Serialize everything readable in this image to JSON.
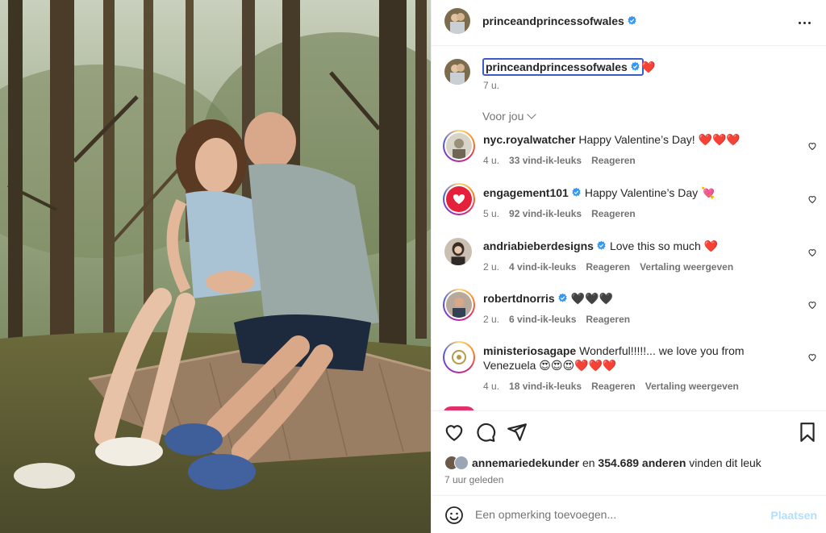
{
  "post": {
    "username": "princeandprincessofwales",
    "caption_emoji": "❤️",
    "caption_time": "7 u.",
    "sort_label": "Voor jou"
  },
  "comments": [
    {
      "username": "nyc.royalwatcher",
      "verified": false,
      "text": "Happy Valentine’s Day! ❤️❤️❤️",
      "time": "4 u.",
      "likes": "33 vind-ik-leuks",
      "reply": "Reageren",
      "translate": ""
    },
    {
      "username": "engagement101",
      "verified": true,
      "text": "Happy Valentine’s Day 💘",
      "time": "5 u.",
      "likes": "92 vind-ik-leuks",
      "reply": "Reageren",
      "translate": ""
    },
    {
      "username": "andriabieberdesigns",
      "verified": true,
      "text": "Love this so much ❤️",
      "time": "2 u.",
      "likes": "4 vind-ik-leuks",
      "reply": "Reageren",
      "translate": "Vertaling weergeven"
    },
    {
      "username": "robertdnorris",
      "verified": true,
      "text": "🖤🖤🖤",
      "time": "2 u.",
      "likes": "6 vind-ik-leuks",
      "reply": "Reageren",
      "translate": ""
    },
    {
      "username": "ministeriosagape",
      "verified": false,
      "text": "Wonderful!!!!!... we love you from Venezuela 😍😍😍❤️❤️❤️",
      "time": "4 u.",
      "likes": "18 vind-ik-leuks",
      "reply": "Reageren",
      "translate": "Vertaling weergeven"
    }
  ],
  "likes": {
    "user": "annemariedekunder",
    "connector": "en",
    "count": "354.689 anderen",
    "suffix": "vinden dit leuk"
  },
  "timeago": "7 uur geleden",
  "add_comment": {
    "placeholder": "Een opmerking toevoegen...",
    "post_label": "Plaatsen"
  },
  "colors": {
    "verified": "#3897f0",
    "link_disabled": "#b2dffc",
    "muted": "#737373",
    "caption_highlight": "#3b5cc4"
  },
  "icons": [
    "more-icon",
    "verified-icon",
    "heart-icon",
    "comment-icon",
    "share-icon",
    "bookmark-icon",
    "emoji-icon",
    "chevron-down-icon"
  ]
}
